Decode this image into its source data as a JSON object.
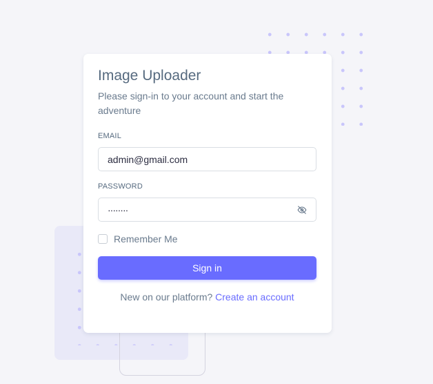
{
  "card": {
    "title": "Image Uploader",
    "subtitle": "Please sign-in to your account and start the adventure"
  },
  "email": {
    "label": "EMAIL",
    "value": "admin@gmail.com"
  },
  "password": {
    "label": "PASSWORD",
    "value": "········",
    "toggle_icon": "eye-off-icon"
  },
  "remember": {
    "label": "Remember Me",
    "checked": false
  },
  "signin": {
    "label": "Sign in"
  },
  "footer": {
    "prompt": "New on our platform?",
    "link": "Create an account"
  },
  "colors": {
    "primary": "#696cff",
    "background": "#f5f5f9",
    "heading": "#566a7f",
    "text": "#697a8d",
    "decor_dots": "#c9c6fb"
  }
}
